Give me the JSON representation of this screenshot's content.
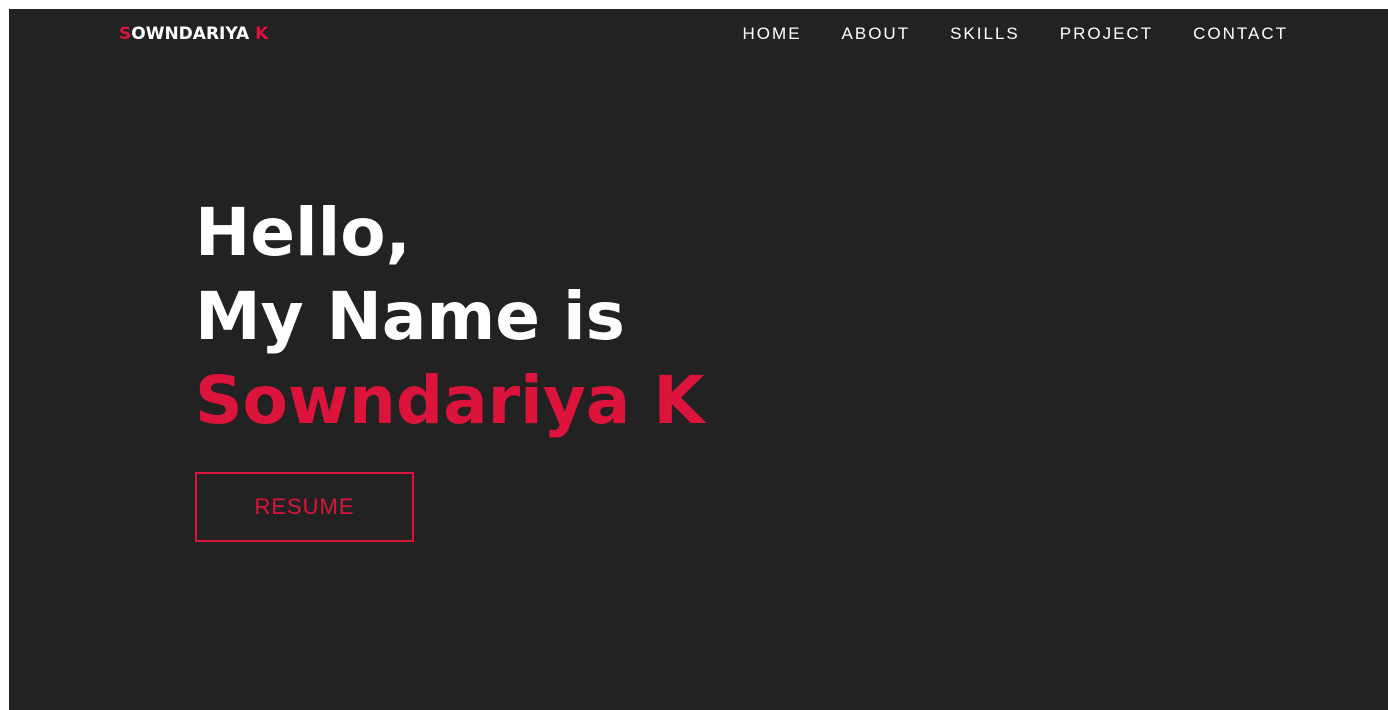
{
  "brand": {
    "first_letter": "S",
    "middle": "OWNDARIYA ",
    "last_letter": "K"
  },
  "nav": {
    "items": [
      "HOME",
      "ABOUT",
      "SKILLS",
      "PROJECT",
      "CONTACT"
    ]
  },
  "hero": {
    "line1": "Hello,",
    "line2": "My Name is",
    "name": "Sowndariya K",
    "resume_label": "RESUME"
  },
  "colors": {
    "background": "#222222",
    "accent": "#dc143c",
    "text": "#ffffff"
  }
}
